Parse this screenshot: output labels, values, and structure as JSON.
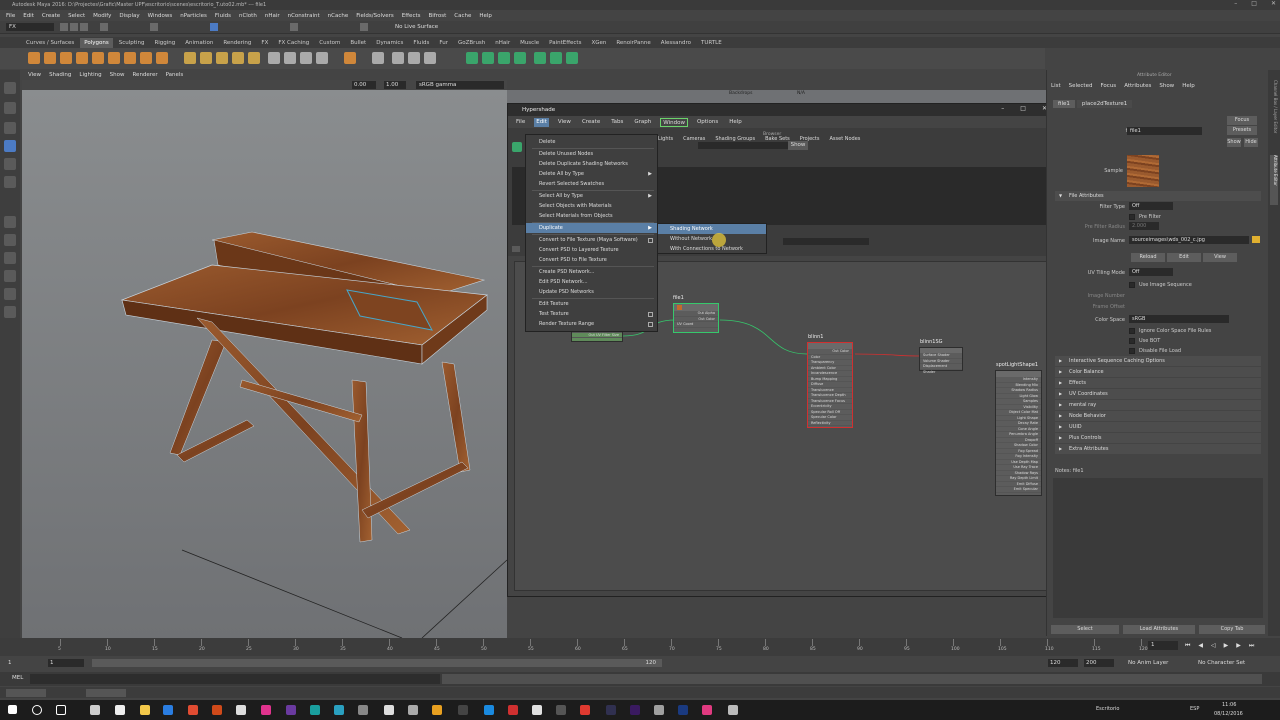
{
  "window": {
    "title": "Autodesk Maya 2016: D:\\Projectes\\Grafic\\Master UPF\\escritorio\\scenes\\escritorio_T.uto02.mb* --- file1"
  },
  "menubar": [
    "File",
    "Edit",
    "Create",
    "Select",
    "Modify",
    "Display",
    "Windows",
    "nParticles",
    "Fluids",
    "nCloth",
    "nHair",
    "nConstraint",
    "nCache",
    "Fields/Solvers",
    "Effects",
    "Bifrost",
    "Cache",
    "Help"
  ],
  "status": {
    "mode": "FX",
    "live_surface": "No Live Surface"
  },
  "shelf_tabs": [
    "Curves / Surfaces",
    "Polygons",
    "Sculpting",
    "Rigging",
    "Animation",
    "Rendering",
    "FX",
    "FX Caching",
    "Custom",
    "Bullet",
    "Dynamics",
    "Fluids",
    "Fur",
    "GoZBrush",
    "nHair",
    "Muscle",
    "PaintEffects",
    "XGen",
    "RenoirPanne",
    "Alessandro",
    "TURTLE"
  ],
  "active_shelf": "Polygons",
  "viewport": {
    "menu": [
      "View",
      "Shading",
      "Lighting",
      "Show",
      "Renderer",
      "Panels"
    ],
    "field1": "0.00",
    "field2": "1.00",
    "colorspace": "sRGB gamma",
    "label": "persp"
  },
  "backdrop": {
    "label": "Backdrops",
    "value": "N/A"
  },
  "hypershade": {
    "title": "Hypershade",
    "menu": [
      "File",
      "Edit",
      "View",
      "Create",
      "Tabs",
      "Graph",
      "Window",
      "Options",
      "Help"
    ],
    "browser_label": "Browser",
    "show_btn": "Show",
    "tabs": [
      "Lights",
      "Cameras",
      "Shading Groups",
      "Bake Sets",
      "Projects",
      "Asset Nodes"
    ]
  },
  "edit_menu": [
    {
      "label": "Delete"
    },
    {
      "label": "Delete Unused Nodes"
    },
    {
      "label": "Delete Duplicate Shading Networks"
    },
    {
      "label": "Delete All by Type",
      "arrow": true
    },
    {
      "label": "Revert Selected Swatches"
    },
    {
      "label": "Select All by Type",
      "arrow": true
    },
    {
      "label": "Select Objects with Materials"
    },
    {
      "label": "Select Materials from Objects"
    },
    {
      "label": "Duplicate",
      "arrow": true,
      "highlight": true
    },
    {
      "label": "Convert to File Texture (Maya Software)",
      "option": true
    },
    {
      "label": "Convert PSD to Layered Texture"
    },
    {
      "label": "Convert PSD to File Texture"
    },
    {
      "label": "Create PSD Network..."
    },
    {
      "label": "Edit PSD Network..."
    },
    {
      "label": "Update PSD Networks"
    },
    {
      "label": "Edit Texture"
    },
    {
      "label": "Test Texture",
      "option": true
    },
    {
      "label": "Render Texture Range",
      "option": true
    }
  ],
  "duplicate_submenu": [
    "Shading Network",
    "Without Network",
    "With Connections to Network"
  ],
  "nodes": {
    "file1": {
      "title": "file1",
      "rows": [
        "Out Alpha",
        "Out Color",
        "UV Coord"
      ]
    },
    "place2d": {
      "rows": [
        "Out UV",
        "Out UV Filter Size"
      ]
    },
    "blinn1": {
      "title": "blinn1",
      "rows": [
        "Out Color",
        "Color",
        "Transparency",
        "Ambient Color",
        "Incandescence",
        "Bump Mapping",
        "Diffuse",
        "Translucence",
        "Translucence Depth",
        "Translucence Focus",
        "Eccentricity",
        "Specular Roll Off",
        "Specular Color",
        "Reflectivity",
        "Reflected Color",
        "Matte Opacity"
      ]
    },
    "blinn1SG": {
      "title": "blinn1SG",
      "rows": [
        "Surface Shader",
        "Volume Shader",
        "Displacement Shader"
      ]
    },
    "spotlight": {
      "title": "spotLightShape1",
      "rows": [
        "Intensity",
        "Blending Mix",
        "Shadow Radius",
        "Light Glow",
        "Samples",
        "Visibility",
        "Object Color Mat",
        "Light Shape",
        "Decay Rate",
        "Cone Angle",
        "Penumbra Angle",
        "Dropoff",
        "Shadow Color",
        "Fog Spread",
        "Fog Intensity",
        "Use Depth Map",
        "Use Ray Trace",
        "Shadow Rays",
        "Ray Depth Limit",
        "Emit Diffuse",
        "Emit Specular",
        "Use Only Trace Shadows"
      ]
    }
  },
  "attribute_editor": {
    "header": "Attribute Editor",
    "menu": [
      "List",
      "Selected",
      "Focus",
      "Attributes",
      "Show",
      "Help"
    ],
    "tabs": [
      "file1",
      "place2dTexture1"
    ],
    "node_label": "file:",
    "node_name": "file1",
    "btns": [
      "Focus",
      "Presets",
      "Show",
      "Hide"
    ],
    "sample_label": "Sample",
    "section_file": "File Attributes",
    "filter_type_label": "Filter Type",
    "filter_type": "Off",
    "pre_filter": "Pre Filter",
    "pre_filter_radius_label": "Pre Filter Radius",
    "pre_filter_radius": "2.000",
    "image_name_label": "Image Name",
    "image_name": "sourceimages\\wds_002_c.jpg",
    "reload_btn": "Reload",
    "edit_btn": "Edit",
    "view_btn": "View",
    "uv_tiling_label": "UV Tiling Mode",
    "uv_tiling": "Off",
    "use_image_seq": "Use Image Sequence",
    "image_number_label": "Image Number",
    "frame_offset_label": "Frame Offset",
    "color_space_label": "Color Space",
    "color_space": "sRGB",
    "ignore_cs": "Ignore Color Space File Rules",
    "use_bot": "Use BOT",
    "disable_file_load": "Disable File Load",
    "sections": [
      "Interactive Sequence Caching Options",
      "Color Balance",
      "Effects",
      "UV Coordinates",
      "mental ray",
      "Node Behavior",
      "UUID",
      "Plus Controls",
      "Extra Attributes"
    ],
    "notes": "Notes: file1",
    "bottom_btns": [
      "Select",
      "Load Attributes",
      "Copy Tab"
    ]
  },
  "side_tabs": [
    "Channel Box / Layer Editor",
    "Attribute Editor"
  ],
  "timeline": {
    "ticks": [
      "5",
      "10",
      "15",
      "20",
      "25",
      "30",
      "35",
      "40",
      "45",
      "50",
      "55",
      "60",
      "65",
      "70",
      "75",
      "80",
      "85",
      "90",
      "95",
      "100",
      "105",
      "110",
      "115",
      "120"
    ],
    "current_frame": "1"
  },
  "range": {
    "start": "1",
    "inner_start": "1",
    "inner_end": "120",
    "end": "120",
    "end2": "200",
    "anim_layer": "No Anim Layer",
    "char_set": "No Character Set"
  },
  "cmdline": {
    "lang": "MEL"
  },
  "taskbar": {
    "app_label": "Escritorio",
    "time": "11:06",
    "date": "08/12/2016",
    "lang": "ESP"
  },
  "colors": {
    "accent": "#5a7fa6",
    "highlight_green": "#6bd36b",
    "node_border_red": "#d13030",
    "wood": "#8b4b24"
  }
}
